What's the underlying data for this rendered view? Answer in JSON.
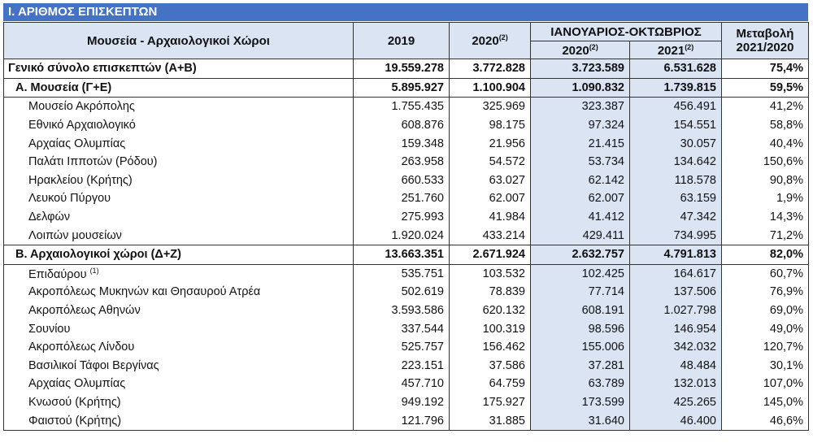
{
  "title": "Ι. ΑΡΙΘΜΟΣ ΕΠΙΣΚΕΠΤΩΝ",
  "headers": {
    "name": "Μουσεία - Αρχαιολογικοί Χώροι",
    "y2019": "2019",
    "y2020": "2020",
    "y2020_note": "(2)",
    "period": "ΙΑΝΟΥΑΡΙΟΣ-ΟΚΤΩΒΡΙΟΣ",
    "p2020": "2020",
    "p2020_note": "(2)",
    "p2021": "2021",
    "p2021_note": "(2)",
    "change_line1": "Μεταβολή",
    "change_line2": "2021/2020"
  },
  "rows": [
    {
      "type": "total",
      "name": "Γενικό  σύνολο επισκεπτών (Α+Β)",
      "note": "",
      "y2019": "19.559.278",
      "y2020": "3.772.828",
      "p2020": "3.723.589",
      "p2021": "6.531.628",
      "change": "75,4%"
    },
    {
      "type": "group",
      "name": "Α. Μουσεία (Γ+Ε)",
      "note": "",
      "y2019": "5.895.927",
      "y2020": "1.100.904",
      "p2020": "1.090.832",
      "p2021": "1.739.815",
      "change": "59,5%"
    },
    {
      "type": "item",
      "name": "Μουσείο Ακρόπολης",
      "note": "",
      "y2019": "1.755.435",
      "y2020": "325.969",
      "p2020": "323.387",
      "p2021": "456.491",
      "change": "41,2%"
    },
    {
      "type": "item",
      "name": "Εθνικό Αρχαιολογικό",
      "note": "",
      "y2019": "608.876",
      "y2020": "98.175",
      "p2020": "97.324",
      "p2021": "154.551",
      "change": "58,8%"
    },
    {
      "type": "item",
      "name": "Αρχαίας Ολυμπίας",
      "note": "",
      "y2019": "159.348",
      "y2020": "21.956",
      "p2020": "21.415",
      "p2021": "30.057",
      "change": "40,4%"
    },
    {
      "type": "item",
      "name": "Παλάτι Ιπποτών (Ρόδου)",
      "note": "",
      "y2019": "263.958",
      "y2020": "54.572",
      "p2020": "53.734",
      "p2021": "134.642",
      "change": "150,6%"
    },
    {
      "type": "item",
      "name": "Ηρακλείου (Κρήτης)",
      "note": "",
      "y2019": "660.533",
      "y2020": "63.027",
      "p2020": "62.142",
      "p2021": "118.578",
      "change": "90,8%"
    },
    {
      "type": "item",
      "name": "Λευκού Πύργου",
      "note": "",
      "y2019": "251.760",
      "y2020": "62.007",
      "p2020": "62.007",
      "p2021": "63.159",
      "change": "1,9%"
    },
    {
      "type": "item",
      "name": "Δελφών",
      "note": "",
      "y2019": "275.993",
      "y2020": "41.984",
      "p2020": "41.412",
      "p2021": "47.342",
      "change": "14,3%"
    },
    {
      "type": "item",
      "name": "Λοιπών μουσείων",
      "note": "",
      "y2019": "1.920.024",
      "y2020": "433.214",
      "p2020": "429.411",
      "p2021": "734.995",
      "change": "71,2%",
      "last": true
    },
    {
      "type": "group",
      "name": "Β. Αρχαιολογικοί χώροι (Δ+Ζ)",
      "note": "",
      "y2019": "13.663.351",
      "y2020": "2.671.924",
      "p2020": "2.632.757",
      "p2021": "4.791.813",
      "change": "82,0%"
    },
    {
      "type": "item",
      "name": "Επιδαύρου",
      "note": "(1)",
      "y2019": "535.751",
      "y2020": "103.532",
      "p2020": "102.425",
      "p2021": "164.617",
      "change": "60,7%"
    },
    {
      "type": "item",
      "name": "Ακροπόλεως Μυκηνών και Θησαυρού Ατρέα",
      "note": "",
      "y2019": "502.619",
      "y2020": "78.839",
      "p2020": "77.714",
      "p2021": "137.506",
      "change": "76,9%"
    },
    {
      "type": "item",
      "name": "Ακροπόλεως Αθηνών",
      "note": "",
      "y2019": "3.593.586",
      "y2020": "620.132",
      "p2020": "608.191",
      "p2021": "1.027.798",
      "change": "69,0%"
    },
    {
      "type": "item",
      "name": "Σουνίου",
      "note": "",
      "y2019": "337.544",
      "y2020": "100.319",
      "p2020": "98.596",
      "p2021": "146.954",
      "change": "49,0%"
    },
    {
      "type": "item",
      "name": "Ακροπόλεως Λίνδου",
      "note": "",
      "y2019": "525.757",
      "y2020": "156.462",
      "p2020": "155.006",
      "p2021": "342.032",
      "change": "120,7%"
    },
    {
      "type": "item",
      "name": "Βασιλικοί Τάφοι Βεργίνας",
      "note": "",
      "y2019": "223.151",
      "y2020": "37.586",
      "p2020": "37.281",
      "p2021": "48.484",
      "change": "30,1%"
    },
    {
      "type": "item",
      "name": "Αρχαίας Ολυμπίας",
      "note": "",
      "y2019": "457.710",
      "y2020": "64.759",
      "p2020": "63.789",
      "p2021": "132.013",
      "change": "107,0%"
    },
    {
      "type": "item",
      "name": "Κνωσού (Κρήτης)",
      "note": "",
      "y2019": "949.192",
      "y2020": "175.927",
      "p2020": "173.599",
      "p2021": "425.265",
      "change": "145,0%"
    },
    {
      "type": "item",
      "name": "Φαιστού (Κρήτης)",
      "note": "",
      "y2019": "121.796",
      "y2020": "31.885",
      "p2020": "31.640",
      "p2021": "46.400",
      "change": "46,6%",
      "last": true
    }
  ],
  "colors": {
    "title_bar": "#4472c4",
    "shaded": "#dbe4f3"
  }
}
